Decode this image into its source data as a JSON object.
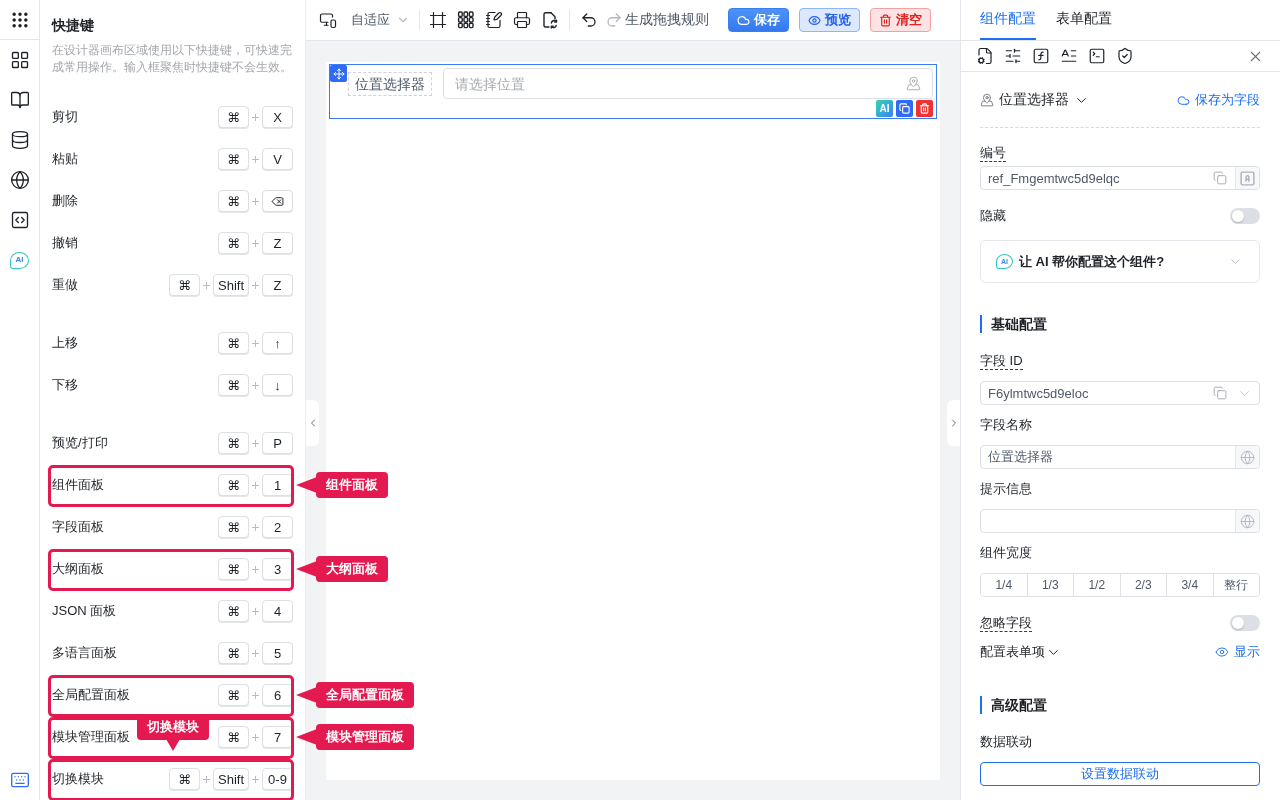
{
  "rail": {
    "items": [
      {
        "selected": false
      },
      {
        "selected": false
      },
      {
        "selected": false
      },
      {
        "selected": false
      },
      {
        "selected": false
      }
    ],
    "ai_item": {
      "label": "AI",
      "selected": false
    },
    "keyboard_item": {
      "selected": true
    }
  },
  "shortcuts": {
    "title": "快捷键",
    "description": "在设计器画布区域使用以下快捷键，可快速完成常用操作。输入框聚焦时快捷键不会生效。",
    "groups": [
      {
        "items": [
          {
            "label": "剪切",
            "highlighted": false,
            "keys": [
              {
                "kind": "char",
                "label": "⌘"
              },
              {
                "kind": "char",
                "label": "X"
              }
            ]
          },
          {
            "label": "粘贴",
            "highlighted": false,
            "keys": [
              {
                "kind": "char",
                "label": "⌘"
              },
              {
                "kind": "char",
                "label": "V"
              }
            ]
          },
          {
            "label": "删除",
            "highlighted": false,
            "keys": [
              {
                "kind": "char",
                "label": "⌘"
              },
              {
                "kind": "backspace"
              }
            ]
          },
          {
            "label": "撤销",
            "highlighted": false,
            "keys": [
              {
                "kind": "char",
                "label": "⌘"
              },
              {
                "kind": "char",
                "label": "Z"
              }
            ]
          },
          {
            "label": "重做",
            "highlighted": false,
            "keys": [
              {
                "kind": "char",
                "label": "⌘"
              },
              {
                "kind": "char",
                "label": "Shift"
              },
              {
                "kind": "char",
                "label": "Z"
              }
            ]
          }
        ]
      },
      {
        "items": [
          {
            "label": "上移",
            "highlighted": false,
            "keys": [
              {
                "kind": "char",
                "label": "⌘"
              },
              {
                "kind": "char",
                "label": "↑"
              }
            ]
          },
          {
            "label": "下移",
            "highlighted": false,
            "keys": [
              {
                "kind": "char",
                "label": "⌘"
              },
              {
                "kind": "char",
                "label": "↓"
              }
            ]
          }
        ]
      },
      {
        "items": [
          {
            "label": "预览/打印",
            "highlighted": false,
            "keys": [
              {
                "kind": "char",
                "label": "⌘"
              },
              {
                "kind": "char",
                "label": "P"
              }
            ]
          },
          {
            "label": "组件面板",
            "highlighted": true,
            "callout": {
              "kind": "beside",
              "text": "组件面板"
            },
            "keys": [
              {
                "kind": "char",
                "label": "⌘"
              },
              {
                "kind": "char",
                "label": "1"
              }
            ]
          },
          {
            "label": "字段面板",
            "highlighted": false,
            "keys": [
              {
                "kind": "char",
                "label": "⌘"
              },
              {
                "kind": "char",
                "label": "2"
              }
            ]
          },
          {
            "label": "大纲面板",
            "highlighted": true,
            "callout": {
              "kind": "beside",
              "text": "大纲面板"
            },
            "keys": [
              {
                "kind": "char",
                "label": "⌘"
              },
              {
                "kind": "char",
                "label": "3"
              }
            ]
          },
          {
            "label": "JSON 面板",
            "highlighted": false,
            "keys": [
              {
                "kind": "char",
                "label": "⌘"
              },
              {
                "kind": "char",
                "label": "4"
              }
            ]
          },
          {
            "label": "多语言面板",
            "highlighted": false,
            "keys": [
              {
                "kind": "char",
                "label": "⌘"
              },
              {
                "kind": "char",
                "label": "5"
              }
            ]
          },
          {
            "label": "全局配置面板",
            "highlighted": true,
            "callout": {
              "kind": "beside",
              "text": "全局配置面板"
            },
            "keys": [
              {
                "kind": "char",
                "label": "⌘"
              },
              {
                "kind": "char",
                "label": "6"
              }
            ]
          },
          {
            "label": "模块管理面板",
            "highlighted": true,
            "callout": {
              "kind": "beside",
              "text": "模块管理面板"
            },
            "keys": [
              {
                "kind": "char",
                "label": "⌘"
              },
              {
                "kind": "char",
                "label": "7"
              }
            ]
          },
          {
            "label": "切换模块",
            "highlighted": true,
            "callout": {
              "kind": "above",
              "text": "切换模块"
            },
            "keys": [
              {
                "kind": "char",
                "label": "⌘"
              },
              {
                "kind": "char",
                "label": "Shift"
              },
              {
                "kind": "char",
                "label": "0-9"
              }
            ]
          }
        ]
      }
    ]
  },
  "toolbar": {
    "viewport": "自适应",
    "history": {
      "undo_disabled": false,
      "redo_disabled": true
    },
    "rule_action": "生成拖拽规则",
    "buttons": [
      {
        "kind": "primary",
        "label": "保存"
      },
      {
        "kind": "info",
        "label": "预览"
      },
      {
        "kind": "danger",
        "label": "清空"
      }
    ]
  },
  "canvas": {
    "field": {
      "label": "位置选择器",
      "placeholder": "请选择位置",
      "selected": true,
      "ai_action": "AI"
    }
  },
  "config_panel": {
    "tabs": [
      {
        "label": "组件配置",
        "selected": true
      },
      {
        "label": "表单配置",
        "selected": false
      }
    ],
    "component": {
      "name": "位置选择器",
      "save_link": "保存为字段"
    },
    "items": [
      {
        "kind": "copy_input",
        "label": "编号",
        "dashed_hint": true,
        "value": "ref_Fmgemtwc5d9elqc"
      },
      {
        "kind": "switch",
        "label": "隐藏",
        "dashed_hint": false,
        "on": false
      },
      {
        "kind": "ai_card",
        "badge": "AI",
        "text": "让 AI 帮你配置这个组件?",
        "expanded": false
      },
      {
        "kind": "section",
        "title": "基础配置"
      },
      {
        "kind": "select",
        "label": "字段 ID",
        "dashed_hint": true,
        "value": "F6ylmtwc5d9eloc"
      },
      {
        "kind": "i18n_input",
        "label": "字段名称",
        "dashed_hint": false,
        "value": "位置选择器"
      },
      {
        "kind": "i18n_input",
        "label": "提示信息",
        "dashed_hint": false
      },
      {
        "kind": "segmented",
        "label": "组件宽度",
        "dashed_hint": false,
        "options": [
          {
            "label": "1/4",
            "selected": false
          },
          {
            "label": "1/3",
            "selected": false
          },
          {
            "label": "1/2",
            "selected": false
          },
          {
            "label": "2/3",
            "selected": false
          },
          {
            "label": "3/4",
            "selected": false
          },
          {
            "label": "整行",
            "selected": false
          }
        ]
      },
      {
        "kind": "switch",
        "label": "忽略字段",
        "dashed_hint": true,
        "on": false
      },
      {
        "kind": "toggle_link",
        "label": "配置表单项",
        "link": "显示"
      },
      {
        "kind": "section",
        "title": "高级配置"
      },
      {
        "kind": "button",
        "label": "数据联动",
        "dashed_hint": false,
        "button": "设置数据联动"
      }
    ]
  }
}
